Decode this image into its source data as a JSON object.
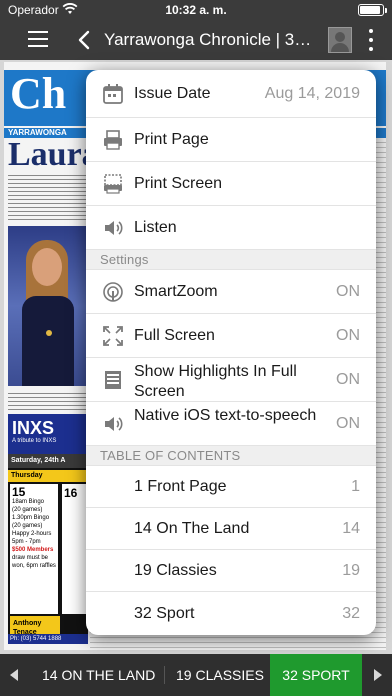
{
  "status_bar": {
    "carrier": "Operador",
    "time": "10:32 a. m."
  },
  "header": {
    "title": "Yarrawonga Chronicle | 32 ..."
  },
  "newspaper": {
    "masthead": "Ch",
    "band_label": "YARRAWONGA",
    "headline": "Laura'",
    "ad_brand": "INXS",
    "ad_sub": "A tribute to INXS",
    "ad_date": "Saturday, 24th A",
    "ad_day": "Thursday",
    "ad_num_1": "15",
    "ad_num_2": "16",
    "ad_lines": [
      "18am Bingo",
      "(20 games)",
      "1.30pm Bingo",
      "(20 games)",
      "Happy 2-hours",
      "5pm - 7pm"
    ],
    "ad_promo_1": "$500 Members",
    "ad_promo_2": "draw must be",
    "ad_promo_3": "won, 6pm raffles",
    "ad_name_1": "Anthony",
    "ad_name_2": "Tenace",
    "ad_phone": "Ph: (03) 5744 1888"
  },
  "popover": {
    "menu": [
      {
        "label": "Issue Date",
        "value": "Aug 14, 2019",
        "icon": "calendar-icon"
      },
      {
        "label": "Print Page",
        "value": "",
        "icon": "print-icon"
      },
      {
        "label": "Print Screen",
        "value": "",
        "icon": "print-screen-icon"
      },
      {
        "label": "Listen",
        "value": "",
        "icon": "speaker-icon"
      }
    ],
    "settings_header": "Settings",
    "settings": [
      {
        "label": "SmartZoom",
        "value": "ON",
        "icon": "smartzoom-icon"
      },
      {
        "label": "Full Screen",
        "value": "ON",
        "icon": "fullscreen-icon"
      },
      {
        "label": "Show Highlights In Full Screen",
        "value": "ON",
        "icon": "highlights-icon"
      },
      {
        "label": "Native iOS text-to-speech",
        "value": "ON",
        "icon": "speaker-icon"
      }
    ],
    "toc_header": "TABLE OF CONTENTS",
    "toc": [
      {
        "label": "1 Front Page",
        "value": "1"
      },
      {
        "label": "14 On The Land",
        "value": "14"
      },
      {
        "label": "19 Classies",
        "value": "19"
      },
      {
        "label": "32 Sport",
        "value": "32"
      }
    ]
  },
  "bottom_bar": {
    "pages": [
      {
        "label": "14 ON THE LAND",
        "active": false
      },
      {
        "label": "19 CLASSIES",
        "active": false
      },
      {
        "label": "32 SPORT",
        "active": true
      }
    ],
    "active_color": "#1f9a2e"
  }
}
